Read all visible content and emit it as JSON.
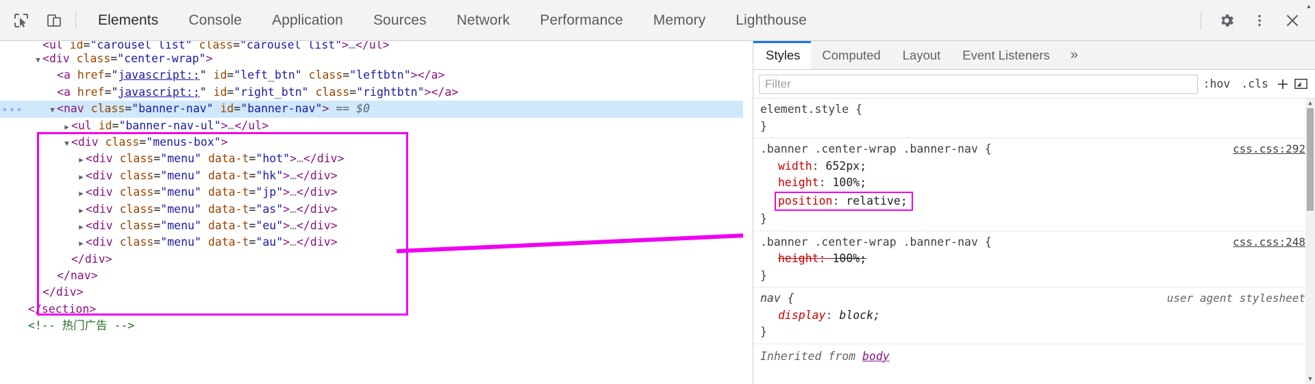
{
  "toolbar": {
    "inspect_icon": "inspect-element-icon",
    "device_icon": "device-toolbar-icon",
    "tabs": [
      {
        "label": "Elements",
        "active": true
      },
      {
        "label": "Console",
        "active": false
      },
      {
        "label": "Application",
        "active": false
      },
      {
        "label": "Sources",
        "active": false
      },
      {
        "label": "Network",
        "active": false
      },
      {
        "label": "Performance",
        "active": false
      },
      {
        "label": "Memory",
        "active": false
      },
      {
        "label": "Lighthouse",
        "active": false
      }
    ],
    "settings_icon": "gear-icon",
    "more_icon": "kebab-menu-icon",
    "close_icon": "close-icon"
  },
  "dom": {
    "rows": [
      {
        "indent": 1,
        "tri": "none",
        "clipped": true,
        "segments": [
          {
            "t": "brk",
            "v": "<"
          },
          {
            "t": "tg",
            "v": "ul"
          },
          {
            "t": "plain",
            "v": " "
          },
          {
            "t": "pn",
            "v": "id"
          },
          {
            "t": "plain",
            "v": "="
          },
          {
            "t": "pv",
            "v": "\"carousel_list\""
          },
          {
            "t": "plain",
            "v": " "
          },
          {
            "t": "pn",
            "v": "class"
          },
          {
            "t": "plain",
            "v": "="
          },
          {
            "t": "pv",
            "v": "\"carousel_list\""
          },
          {
            "t": "brk",
            "v": ">"
          },
          {
            "t": "ell",
            "v": "…"
          },
          {
            "t": "brk",
            "v": "</"
          },
          {
            "t": "tg",
            "v": "ul"
          },
          {
            "t": "brk",
            "v": ">"
          }
        ]
      },
      {
        "indent": 1,
        "tri": "open",
        "segments": [
          {
            "t": "brk",
            "v": "<"
          },
          {
            "t": "tg",
            "v": "div"
          },
          {
            "t": "plain",
            "v": " "
          },
          {
            "t": "pn",
            "v": "class"
          },
          {
            "t": "plain",
            "v": "="
          },
          {
            "t": "pv",
            "v": "\"center-wrap\""
          },
          {
            "t": "brk",
            "v": ">"
          }
        ]
      },
      {
        "indent": 2,
        "tri": "none",
        "segments": [
          {
            "t": "brk",
            "v": "<"
          },
          {
            "t": "tg",
            "v": "a"
          },
          {
            "t": "plain",
            "v": " "
          },
          {
            "t": "pn",
            "v": "href"
          },
          {
            "t": "plain",
            "v": "="
          },
          {
            "t": "plain",
            "v": "\""
          },
          {
            "t": "lnk",
            "v": "javascript:;"
          },
          {
            "t": "plain",
            "v": "\""
          },
          {
            "t": "plain",
            "v": " "
          },
          {
            "t": "pn",
            "v": "id"
          },
          {
            "t": "plain",
            "v": "="
          },
          {
            "t": "pv",
            "v": "\"left_btn\""
          },
          {
            "t": "plain",
            "v": " "
          },
          {
            "t": "pn",
            "v": "class"
          },
          {
            "t": "plain",
            "v": "="
          },
          {
            "t": "pv",
            "v": "\"leftbtn\""
          },
          {
            "t": "brk",
            "v": "></"
          },
          {
            "t": "tg",
            "v": "a"
          },
          {
            "t": "brk",
            "v": ">"
          }
        ]
      },
      {
        "indent": 2,
        "tri": "none",
        "segments": [
          {
            "t": "brk",
            "v": "<"
          },
          {
            "t": "tg",
            "v": "a"
          },
          {
            "t": "plain",
            "v": " "
          },
          {
            "t": "pn",
            "v": "href"
          },
          {
            "t": "plain",
            "v": "="
          },
          {
            "t": "plain",
            "v": "\""
          },
          {
            "t": "lnk",
            "v": "javascript:;"
          },
          {
            "t": "plain",
            "v": "\""
          },
          {
            "t": "plain",
            "v": " "
          },
          {
            "t": "pn",
            "v": "id"
          },
          {
            "t": "plain",
            "v": "="
          },
          {
            "t": "pv",
            "v": "\"right_btn\""
          },
          {
            "t": "plain",
            "v": " "
          },
          {
            "t": "pn",
            "v": "class"
          },
          {
            "t": "plain",
            "v": "="
          },
          {
            "t": "pv",
            "v": "\"rightbtn\""
          },
          {
            "t": "brk",
            "v": "></"
          },
          {
            "t": "tg",
            "v": "a"
          },
          {
            "t": "brk",
            "v": ">"
          }
        ]
      },
      {
        "indent": 2,
        "tri": "open",
        "selected": true,
        "badge": "…",
        "segments": [
          {
            "t": "brk",
            "v": "<"
          },
          {
            "t": "tg",
            "v": "nav"
          },
          {
            "t": "plain",
            "v": " "
          },
          {
            "t": "pn",
            "v": "class"
          },
          {
            "t": "plain",
            "v": "="
          },
          {
            "t": "pv",
            "v": "\"banner-nav\""
          },
          {
            "t": "plain",
            "v": " "
          },
          {
            "t": "pn",
            "v": "id"
          },
          {
            "t": "plain",
            "v": "="
          },
          {
            "t": "pv",
            "v": "\"banner-nav\""
          },
          {
            "t": "brk",
            "v": ">"
          },
          {
            "t": "plain",
            "v": " "
          },
          {
            "t": "dollar",
            "v": "== $0"
          }
        ]
      },
      {
        "indent": 3,
        "tri": "closed",
        "segments": [
          {
            "t": "brk",
            "v": "<"
          },
          {
            "t": "tg",
            "v": "ul"
          },
          {
            "t": "plain",
            "v": " "
          },
          {
            "t": "pn",
            "v": "id"
          },
          {
            "t": "plain",
            "v": "="
          },
          {
            "t": "pv",
            "v": "\"banner-nav-ul\""
          },
          {
            "t": "brk",
            "v": ">"
          },
          {
            "t": "ell",
            "v": "…"
          },
          {
            "t": "brk",
            "v": "</"
          },
          {
            "t": "tg",
            "v": "ul"
          },
          {
            "t": "brk",
            "v": ">"
          }
        ]
      },
      {
        "indent": 3,
        "tri": "open",
        "segments": [
          {
            "t": "brk",
            "v": "<"
          },
          {
            "t": "tg",
            "v": "div"
          },
          {
            "t": "plain",
            "v": " "
          },
          {
            "t": "pn",
            "v": "class"
          },
          {
            "t": "plain",
            "v": "="
          },
          {
            "t": "pv",
            "v": "\"menus-box\""
          },
          {
            "t": "brk",
            "v": ">"
          }
        ]
      },
      {
        "indent": 4,
        "tri": "closed",
        "segments": [
          {
            "t": "brk",
            "v": "<"
          },
          {
            "t": "tg",
            "v": "div"
          },
          {
            "t": "plain",
            "v": " "
          },
          {
            "t": "pn",
            "v": "class"
          },
          {
            "t": "plain",
            "v": "="
          },
          {
            "t": "pv",
            "v": "\"menu\""
          },
          {
            "t": "plain",
            "v": " "
          },
          {
            "t": "pn",
            "v": "data-t"
          },
          {
            "t": "plain",
            "v": "="
          },
          {
            "t": "pv",
            "v": "\"hot\""
          },
          {
            "t": "brk",
            "v": ">"
          },
          {
            "t": "ell",
            "v": "…"
          },
          {
            "t": "brk",
            "v": "</"
          },
          {
            "t": "tg",
            "v": "div"
          },
          {
            "t": "brk",
            "v": ">"
          }
        ]
      },
      {
        "indent": 4,
        "tri": "closed",
        "segments": [
          {
            "t": "brk",
            "v": "<"
          },
          {
            "t": "tg",
            "v": "div"
          },
          {
            "t": "plain",
            "v": " "
          },
          {
            "t": "pn",
            "v": "class"
          },
          {
            "t": "plain",
            "v": "="
          },
          {
            "t": "pv",
            "v": "\"menu\""
          },
          {
            "t": "plain",
            "v": " "
          },
          {
            "t": "pn",
            "v": "data-t"
          },
          {
            "t": "plain",
            "v": "="
          },
          {
            "t": "pv",
            "v": "\"hk\""
          },
          {
            "t": "brk",
            "v": ">"
          },
          {
            "t": "ell",
            "v": "…"
          },
          {
            "t": "brk",
            "v": "</"
          },
          {
            "t": "tg",
            "v": "div"
          },
          {
            "t": "brk",
            "v": ">"
          }
        ]
      },
      {
        "indent": 4,
        "tri": "closed",
        "segments": [
          {
            "t": "brk",
            "v": "<"
          },
          {
            "t": "tg",
            "v": "div"
          },
          {
            "t": "plain",
            "v": " "
          },
          {
            "t": "pn",
            "v": "class"
          },
          {
            "t": "plain",
            "v": "="
          },
          {
            "t": "pv",
            "v": "\"menu\""
          },
          {
            "t": "plain",
            "v": " "
          },
          {
            "t": "pn",
            "v": "data-t"
          },
          {
            "t": "plain",
            "v": "="
          },
          {
            "t": "pv",
            "v": "\"jp\""
          },
          {
            "t": "brk",
            "v": ">"
          },
          {
            "t": "ell",
            "v": "…"
          },
          {
            "t": "brk",
            "v": "</"
          },
          {
            "t": "tg",
            "v": "div"
          },
          {
            "t": "brk",
            "v": ">"
          }
        ]
      },
      {
        "indent": 4,
        "tri": "closed",
        "segments": [
          {
            "t": "brk",
            "v": "<"
          },
          {
            "t": "tg",
            "v": "div"
          },
          {
            "t": "plain",
            "v": " "
          },
          {
            "t": "pn",
            "v": "class"
          },
          {
            "t": "plain",
            "v": "="
          },
          {
            "t": "pv",
            "v": "\"menu\""
          },
          {
            "t": "plain",
            "v": " "
          },
          {
            "t": "pn",
            "v": "data-t"
          },
          {
            "t": "plain",
            "v": "="
          },
          {
            "t": "pv",
            "v": "\"as\""
          },
          {
            "t": "brk",
            "v": ">"
          },
          {
            "t": "ell",
            "v": "…"
          },
          {
            "t": "brk",
            "v": "</"
          },
          {
            "t": "tg",
            "v": "div"
          },
          {
            "t": "brk",
            "v": ">"
          }
        ]
      },
      {
        "indent": 4,
        "tri": "closed",
        "segments": [
          {
            "t": "brk",
            "v": "<"
          },
          {
            "t": "tg",
            "v": "div"
          },
          {
            "t": "plain",
            "v": " "
          },
          {
            "t": "pn",
            "v": "class"
          },
          {
            "t": "plain",
            "v": "="
          },
          {
            "t": "pv",
            "v": "\"menu\""
          },
          {
            "t": "plain",
            "v": " "
          },
          {
            "t": "pn",
            "v": "data-t"
          },
          {
            "t": "plain",
            "v": "="
          },
          {
            "t": "pv",
            "v": "\"eu\""
          },
          {
            "t": "brk",
            "v": ">"
          },
          {
            "t": "ell",
            "v": "…"
          },
          {
            "t": "brk",
            "v": "</"
          },
          {
            "t": "tg",
            "v": "div"
          },
          {
            "t": "brk",
            "v": ">"
          }
        ]
      },
      {
        "indent": 4,
        "tri": "closed",
        "segments": [
          {
            "t": "brk",
            "v": "<"
          },
          {
            "t": "tg",
            "v": "div"
          },
          {
            "t": "plain",
            "v": " "
          },
          {
            "t": "pn",
            "v": "class"
          },
          {
            "t": "plain",
            "v": "="
          },
          {
            "t": "pv",
            "v": "\"menu\""
          },
          {
            "t": "plain",
            "v": " "
          },
          {
            "t": "pn",
            "v": "data-t"
          },
          {
            "t": "plain",
            "v": "="
          },
          {
            "t": "pv",
            "v": "\"au\""
          },
          {
            "t": "brk",
            "v": ">"
          },
          {
            "t": "ell",
            "v": "…"
          },
          {
            "t": "brk",
            "v": "</"
          },
          {
            "t": "tg",
            "v": "div"
          },
          {
            "t": "brk",
            "v": ">"
          }
        ]
      },
      {
        "indent": 3,
        "tri": "none",
        "segments": [
          {
            "t": "brk",
            "v": "</"
          },
          {
            "t": "tg",
            "v": "div"
          },
          {
            "t": "brk",
            "v": ">"
          }
        ]
      },
      {
        "indent": 2,
        "tri": "none",
        "segments": [
          {
            "t": "brk",
            "v": "</"
          },
          {
            "t": "tg",
            "v": "nav"
          },
          {
            "t": "brk",
            "v": ">"
          }
        ]
      },
      {
        "indent": 1,
        "tri": "none",
        "segments": [
          {
            "t": "brk",
            "v": "</"
          },
          {
            "t": "tg",
            "v": "div"
          },
          {
            "t": "brk",
            "v": ">"
          }
        ]
      },
      {
        "indent": 0,
        "tri": "none",
        "segments": [
          {
            "t": "brk",
            "v": "</"
          },
          {
            "t": "tg",
            "v": "section"
          },
          {
            "t": "brk",
            "v": ">"
          }
        ]
      },
      {
        "indent": 0,
        "tri": "none",
        "clipped_bottom": true,
        "segments": [
          {
            "t": "cmt",
            "v": "<!-- 热门广告 -->"
          }
        ]
      }
    ]
  },
  "styles": {
    "tabs": [
      {
        "label": "Styles",
        "active": true
      },
      {
        "label": "Computed",
        "active": false
      },
      {
        "label": "Layout",
        "active": false
      },
      {
        "label": "Event Listeners",
        "active": false
      }
    ],
    "more_tabs_icon": "chevron-double-right-icon",
    "filter": {
      "value": "",
      "placeholder": "Filter"
    },
    "hov_label": ":hov",
    "cls_label": ".cls",
    "new_rule_icon": "plus-icon",
    "toggle_sidebar_icon": "toggle-element-classes-icon",
    "rules": [
      {
        "selector": "element.style",
        "origin": "",
        "origin_is_ua": false,
        "declarations": []
      },
      {
        "selector": ".banner .center-wrap .banner-nav",
        "origin": "css.css:292",
        "origin_is_ua": false,
        "declarations": [
          {
            "prop": "width",
            "value": "652px",
            "struck": false,
            "highlighted": false
          },
          {
            "prop": "height",
            "value": "100%",
            "struck": false,
            "highlighted": false
          },
          {
            "prop": "position",
            "value": "relative",
            "struck": false,
            "highlighted": true
          }
        ]
      },
      {
        "selector": ".banner .center-wrap .banner-nav",
        "origin": "css.css:248",
        "origin_is_ua": false,
        "declarations": [
          {
            "prop": "height",
            "value": "100%",
            "struck": true,
            "highlighted": false
          }
        ]
      },
      {
        "selector": "nav",
        "origin": "user agent stylesheet",
        "origin_is_ua": true,
        "declarations": [
          {
            "prop": "display",
            "value": "block",
            "struck": false,
            "highlighted": false,
            "italic": true
          }
        ]
      }
    ],
    "inherited_label": "Inherited from ",
    "inherited_from": "body"
  },
  "annotation": {
    "color": "#ef00ef",
    "nav_box_name": "nav-subtree-highlight-box",
    "arrow_name": "pink-annotation-arrow",
    "position_box_name": "position-relative-highlight-box"
  }
}
